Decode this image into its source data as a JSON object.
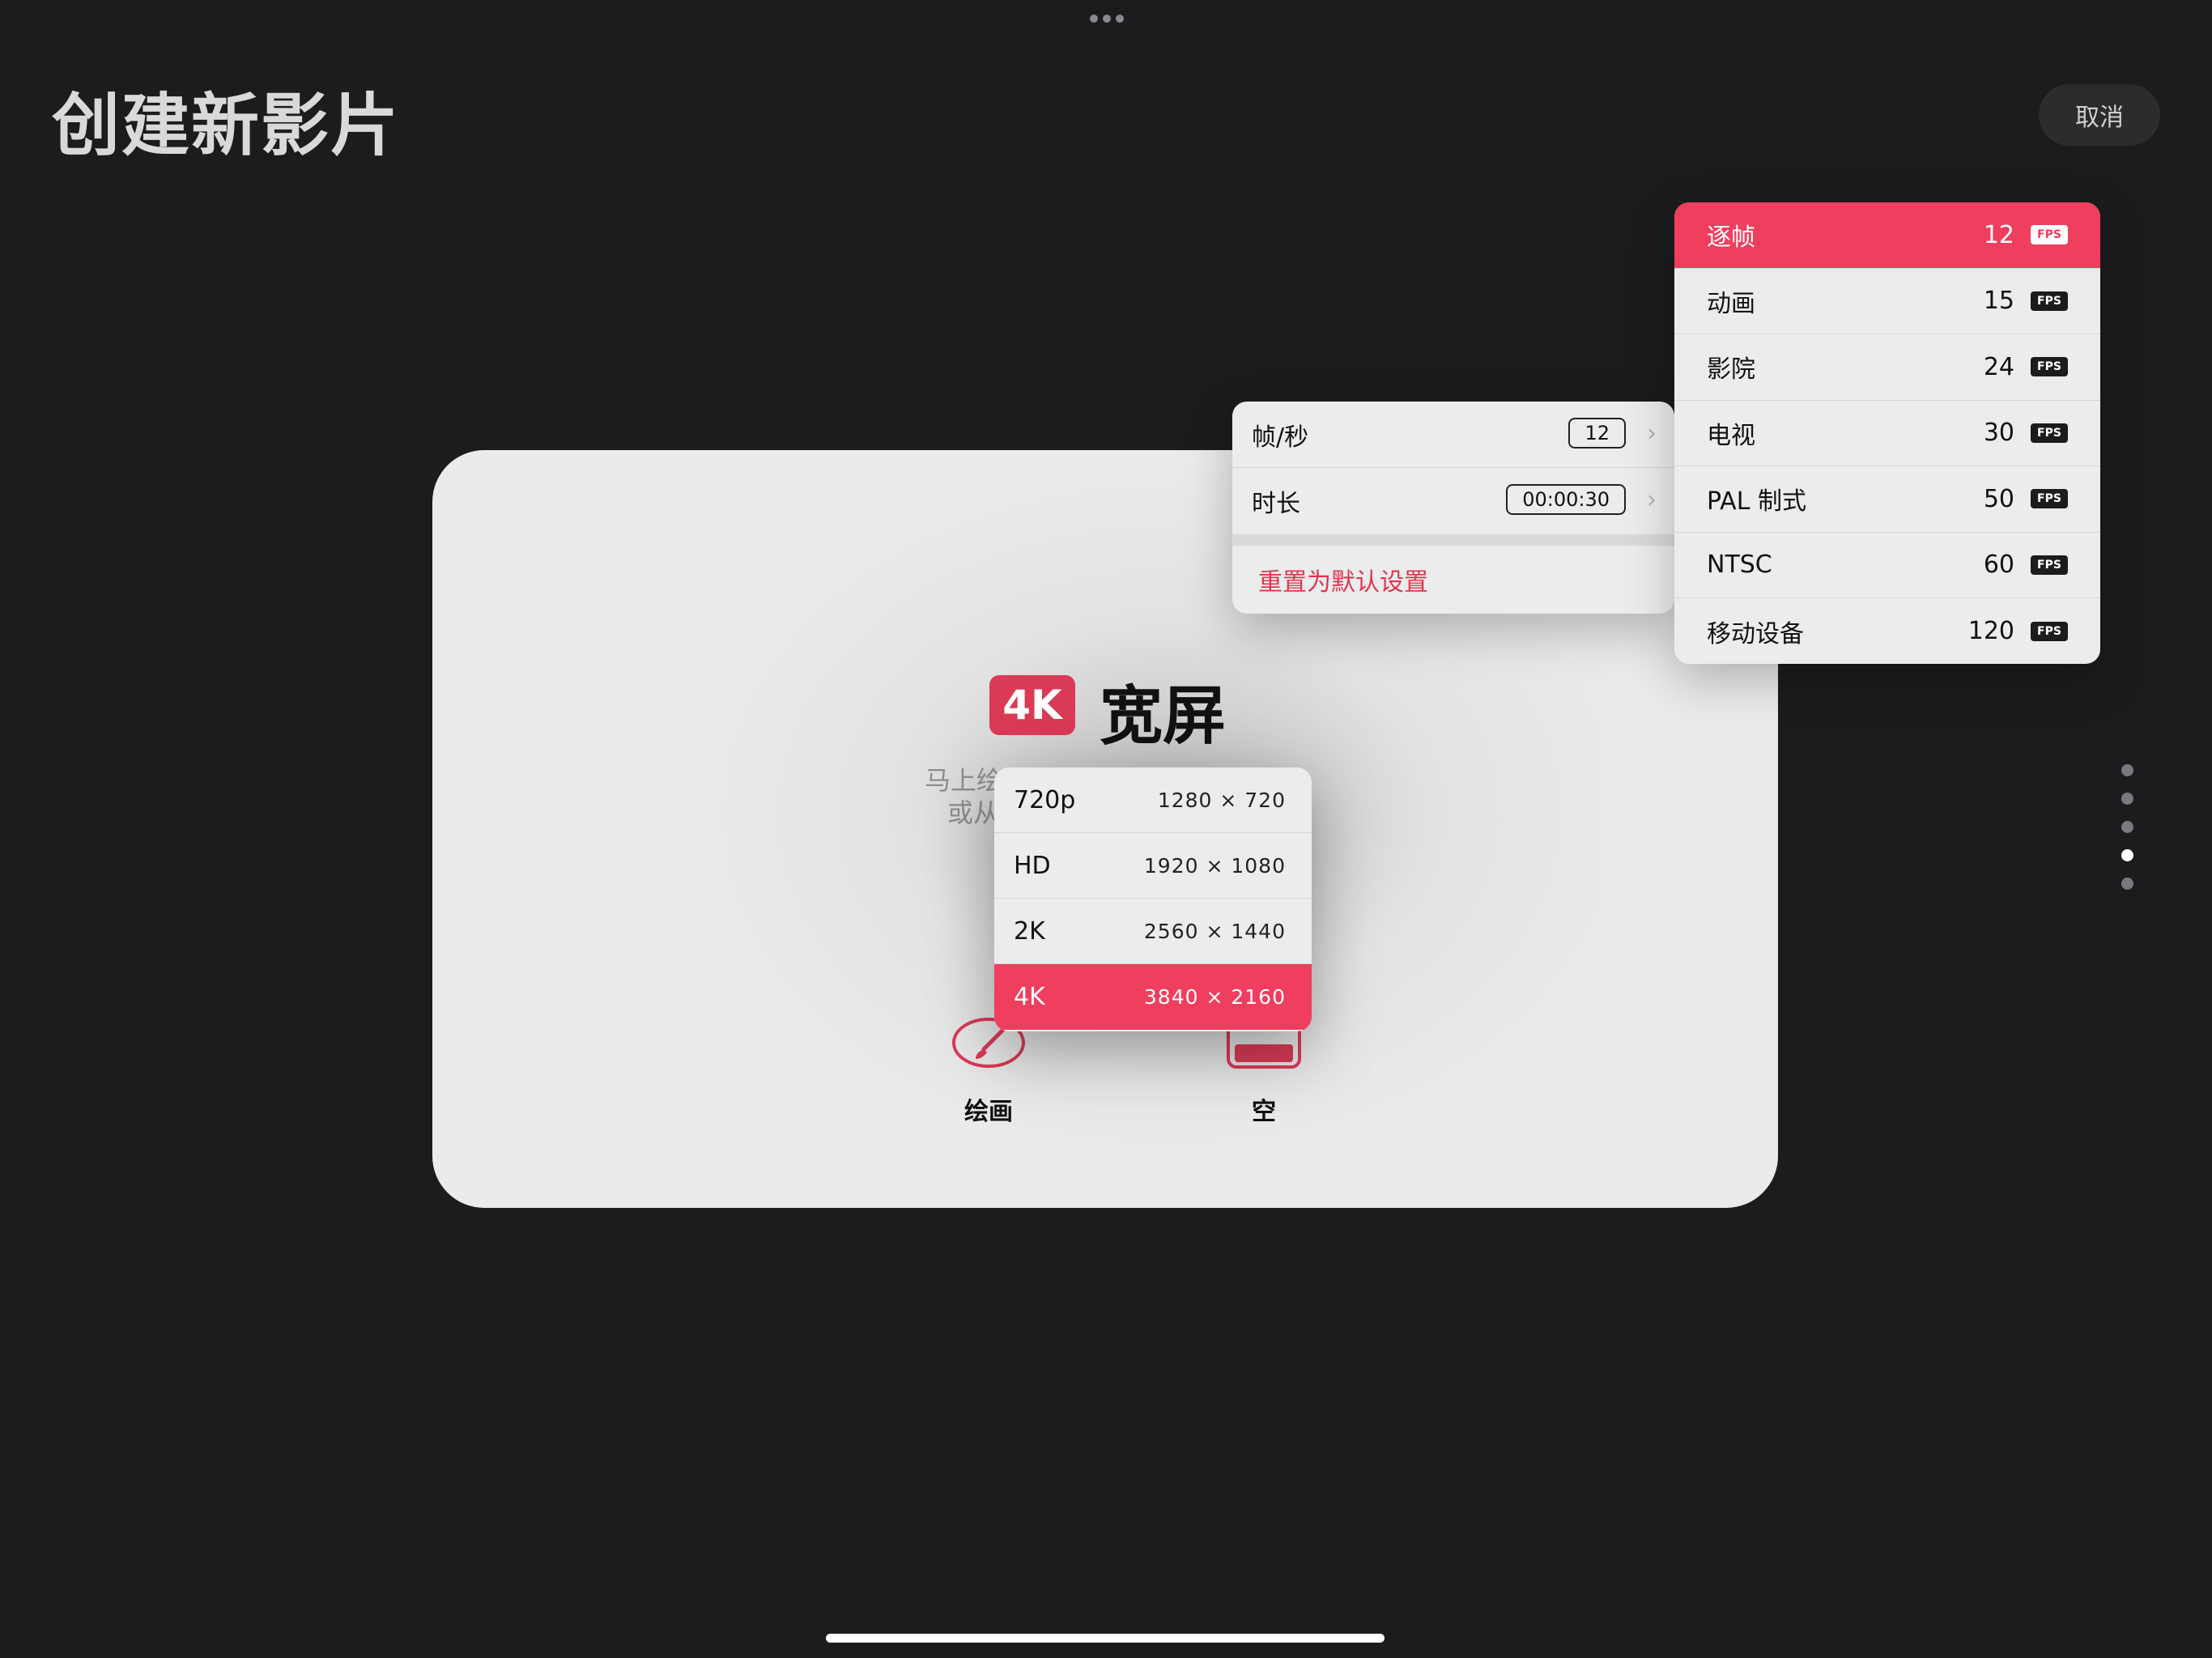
{
  "header": {
    "title": "创建新影片",
    "cancel_label": "取消"
  },
  "card": {
    "badge": "4K",
    "title": "宽屏",
    "subtext_line1": "马上绘",
    "subtext_line2": "或从",
    "options": [
      {
        "label": "绘画",
        "icon": "paintbrush-icon"
      },
      {
        "label": "空",
        "icon": "blank-canvas-icon"
      }
    ]
  },
  "resolution_menu": {
    "items": [
      {
        "name": "720p",
        "dims": "1280 × 720"
      },
      {
        "name": "HD",
        "dims": "1920 × 1080"
      },
      {
        "name": "2K",
        "dims": "2560 × 1440"
      },
      {
        "name": "4K",
        "dims": "3840 × 2160"
      }
    ],
    "selected": "4K"
  },
  "settings": {
    "fps_label": "帧/秒",
    "fps_value": "12",
    "duration_label": "时长",
    "duration_value": "00:00:30",
    "reset_label": "重置为默认设置"
  },
  "fps_menu": {
    "tag": "FPS",
    "items": [
      {
        "name": "逐帧",
        "value": "12"
      },
      {
        "name": "动画",
        "value": "15"
      },
      {
        "name": "影院",
        "value": "24"
      },
      {
        "name": "电视",
        "value": "30"
      },
      {
        "name": "PAL 制式",
        "value": "50"
      },
      {
        "name": "NTSC",
        "value": "60"
      },
      {
        "name": "移动设备",
        "value": "120"
      }
    ],
    "selected": "逐帧"
  },
  "page_indicator": {
    "count": 5,
    "active_index": 3
  },
  "colors": {
    "accent": "#ef3e5e",
    "background": "#1c1c1e",
    "card": "#ebebeb"
  }
}
